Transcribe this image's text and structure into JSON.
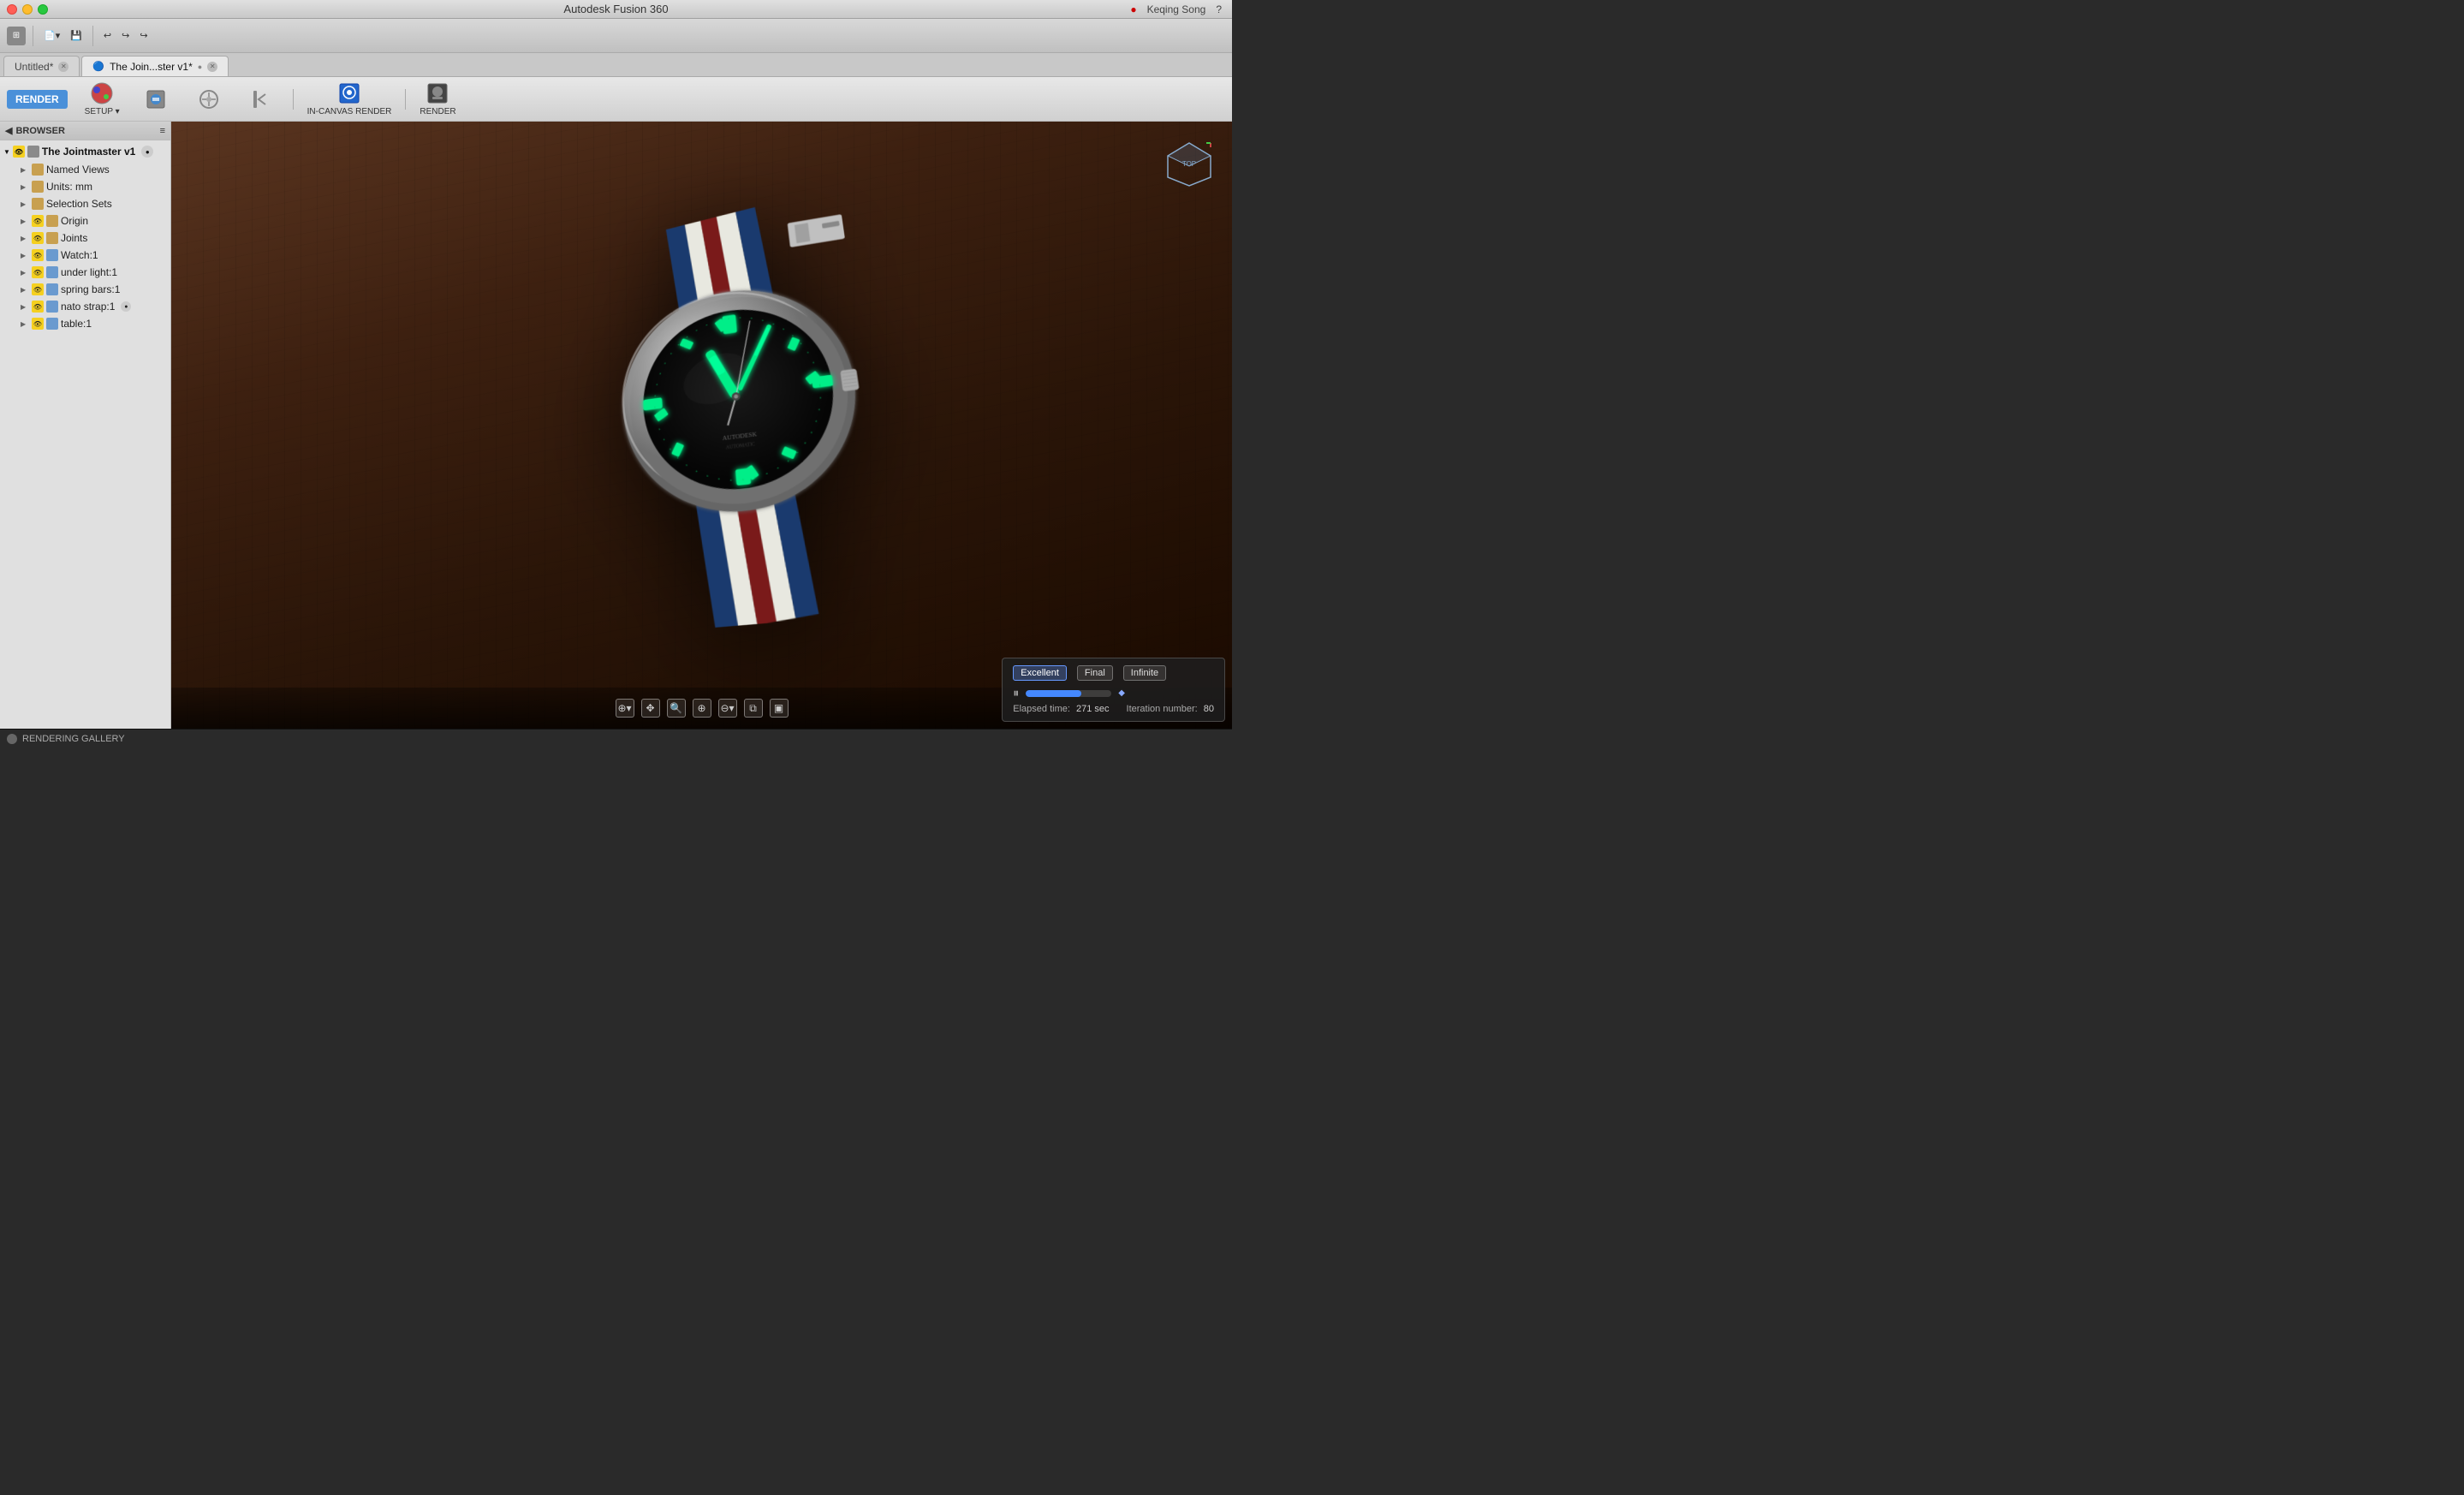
{
  "window": {
    "title": "Autodesk Fusion 360",
    "user": "Keqing Song"
  },
  "tabs": [
    {
      "label": "Untitled*",
      "active": false,
      "modified": true
    },
    {
      "label": "The Join...ster v1*",
      "active": true,
      "modified": true
    }
  ],
  "toolbar": {
    "render_label": "RENDER",
    "setup_label": "SETUP",
    "in_canvas_label": "IN-CANVAS RENDER",
    "render_btn_label": "RENDER"
  },
  "browser": {
    "title": "BROWSER",
    "root_label": "The Jointmaster v1",
    "items": [
      {
        "label": "Named Views",
        "type": "folder",
        "depth": 1
      },
      {
        "label": "Units: mm",
        "type": "folder",
        "depth": 1
      },
      {
        "label": "Selection Sets",
        "type": "folder",
        "depth": 1
      },
      {
        "label": "Origin",
        "type": "folder",
        "depth": 1,
        "eye": true
      },
      {
        "label": "Joints",
        "type": "folder",
        "depth": 1,
        "eye": true
      },
      {
        "label": "Watch:1",
        "type": "item",
        "depth": 1,
        "eye": true
      },
      {
        "label": "under light:1",
        "type": "item",
        "depth": 1,
        "eye": true
      },
      {
        "label": "spring bars:1",
        "type": "item",
        "depth": 1,
        "eye": true
      },
      {
        "label": "nato strap:1",
        "type": "item",
        "depth": 1,
        "eye": true,
        "badge": true
      },
      {
        "label": "table:1",
        "type": "item",
        "depth": 1,
        "eye": true
      }
    ]
  },
  "render": {
    "quality_options": [
      "Excellent",
      "Final",
      "Infinite"
    ],
    "active_quality": "Excellent",
    "elapsed_label": "Elapsed time:",
    "elapsed_value": "271 sec",
    "iteration_label": "Iteration number:",
    "iteration_value": "80",
    "progress_percent": 65
  },
  "statusbar": {
    "label": "RENDERING GALLERY"
  },
  "hud_icons": [
    "⊕",
    "↔",
    "🔍",
    "⊕",
    "⊖",
    "⧉",
    "▣"
  ]
}
